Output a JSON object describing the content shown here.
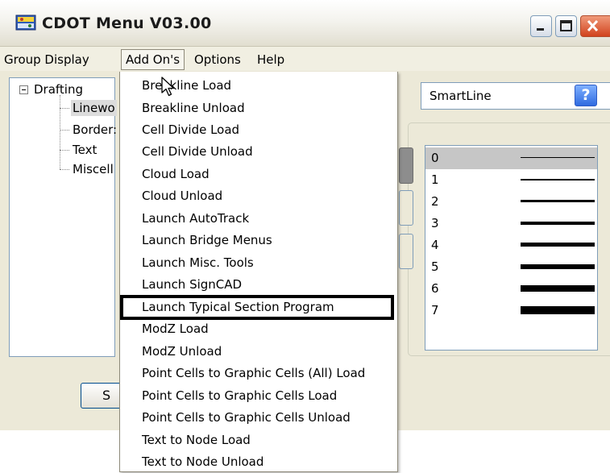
{
  "window": {
    "title": "CDOT Menu V03.00",
    "icon": "cdot-app-icon"
  },
  "menubar": {
    "items": [
      {
        "label": "Group Display"
      },
      {
        "label": "Add On's"
      },
      {
        "label": "Options"
      },
      {
        "label": "Help"
      }
    ],
    "active": "Add On's"
  },
  "tree": {
    "root": "Drafting",
    "children": [
      "Linewo",
      "Border:",
      "Text",
      "Miscell"
    ],
    "selected": "Linewo"
  },
  "left_button": {
    "label": "S"
  },
  "combo": {
    "value": "SmartLine"
  },
  "help_button": {
    "label": "?"
  },
  "weights": {
    "items": [
      "0",
      "1",
      "2",
      "3",
      "4",
      "5",
      "6",
      "7"
    ],
    "selected": "0"
  },
  "dropdown": {
    "items": [
      "Breakline Load",
      "Breakline Unload",
      "Cell Divide Load",
      "Cell Divide Unload",
      "Cloud Load",
      "Cloud Unload",
      "Launch AutoTrack",
      "Launch Bridge Menus",
      "Launch Misc. Tools",
      "Launch SignCAD",
      "Launch Typical Section Program",
      "ModZ Load",
      "ModZ Unload",
      "Point Cells to Graphic Cells (All) Load",
      "Point Cells to Graphic Cells Load",
      "Point Cells to Graphic Cells Unload",
      "Text to Node Load",
      "Text to Node Unload"
    ],
    "highlighted": "Launch Typical Section Program"
  },
  "colors": {
    "window_bg": "#ece9d8",
    "menubar_bg": "#f1efe2",
    "highlight_border": "#000000",
    "close_button": "#d1431e"
  }
}
